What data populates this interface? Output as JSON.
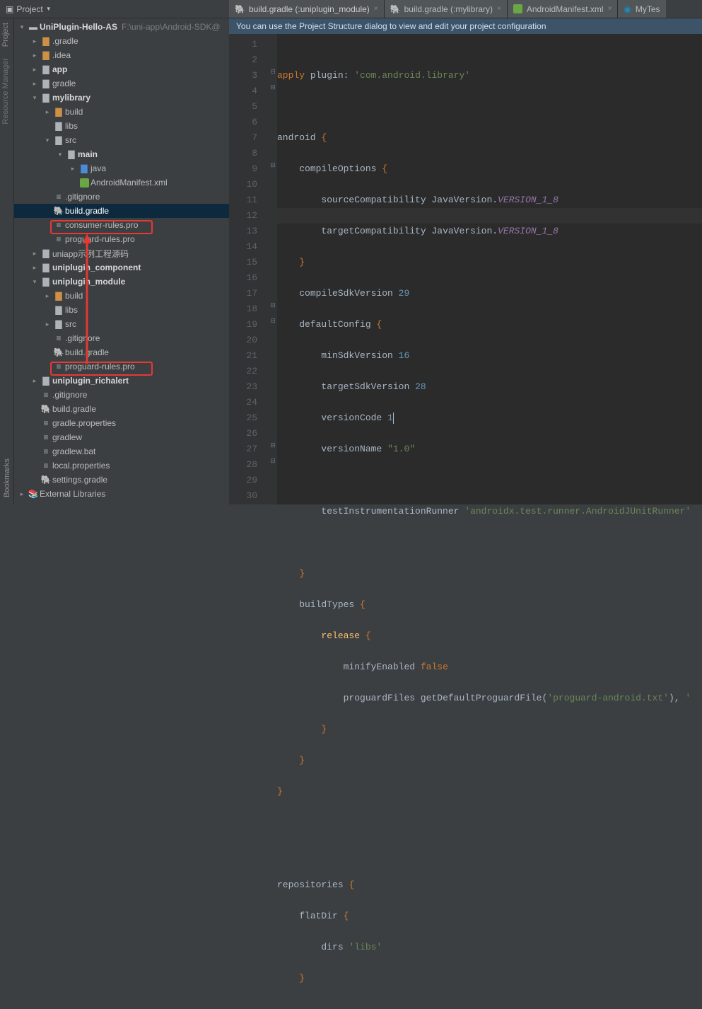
{
  "topbar": {
    "project": "Project"
  },
  "rails": {
    "r1": "Project",
    "r2": "Resource Manager",
    "r3": "Bookmarks"
  },
  "root": {
    "name": "UniPlugin-Hello-AS",
    "path": "F:\\uni-app\\Android-SDK@"
  },
  "tree": {
    "gradle": ".gradle",
    "idea": ".idea",
    "app": "app",
    "gradle2": "gradle",
    "mylibrary": "mylibrary",
    "build": "build",
    "libs": "libs",
    "src": "src",
    "main": "main",
    "java": "java",
    "manifest": "AndroidManifest.xml",
    "gitignore": ".gitignore",
    "buildgradle": "build.gradle",
    "consumer": "consumer-rules.pro",
    "proguard": "proguard-rules.pro",
    "uniappex": "uniapp示例工程源码",
    "uniplugin_component": "uniplugin_component",
    "uniplugin_module": "uniplugin_module",
    "uniplugin_richalert": "uniplugin_richalert",
    "gradleprop": "gradle.properties",
    "gradlew": "gradlew",
    "gradlewbat": "gradlew.bat",
    "localprop": "local.properties",
    "settings": "settings.gradle",
    "extlib": "External Libraries"
  },
  "tabs": {
    "t1": "build.gradle (:uniplugin_module)",
    "t2": "build.gradle (:mylibrary)",
    "t3": "AndroidManifest.xml",
    "t4": "MyTes"
  },
  "info": "You can use the Project Structure dialog to view and edit your project configuration",
  "code": {
    "l1a": "apply",
    "l1b": "plugin",
    "l1c": "'com.android.library'",
    "l3a": "android",
    "l4a": "compileOptions",
    "l5a": "sourceCompatibility",
    "l5b": "JavaVersion",
    "l5c": "VERSION_1_8",
    "l6a": "targetCompatibility",
    "l8a": "compileSdkVersion",
    "l8b": "29",
    "l9a": "defaultConfig",
    "l10a": "minSdkVersion",
    "l10b": "16",
    "l11a": "targetSdkVersion",
    "l11b": "28",
    "l12a": "versionCode",
    "l12b": "1",
    "l13a": "versionName",
    "l13b": "\"1.0\"",
    "l15a": "testInstrumentationRunner",
    "l15b": "'androidx.test.runner.AndroidJUnitRunner'",
    "l18a": "buildTypes",
    "l19a": "release",
    "l20a": "minifyEnabled",
    "l20b": "false",
    "l21a": "proguardFiles",
    "l21b": "getDefaultProguardFile",
    "l21c": "'proguard-android.txt'",
    "l27a": "repositories",
    "l28a": "flatDir",
    "l29a": "dirs",
    "l29b": "'libs'"
  },
  "lines": [
    "1",
    "2",
    "3",
    "4",
    "5",
    "6",
    "7",
    "8",
    "9",
    "10",
    "11",
    "12",
    "13",
    "14",
    "15",
    "16",
    "17",
    "18",
    "19",
    "20",
    "21",
    "22",
    "23",
    "24",
    "25",
    "26",
    "27",
    "28",
    "29",
    "30"
  ]
}
